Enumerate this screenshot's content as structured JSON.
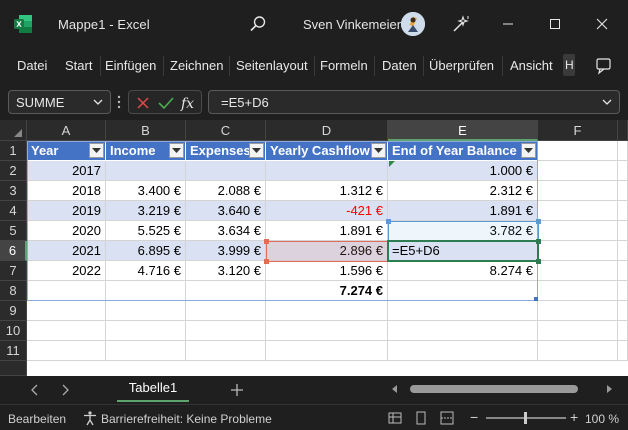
{
  "window": {
    "title": "Mappe1  -  Excel",
    "user": "Sven Vinkemeier"
  },
  "ribbon": {
    "tabs": [
      "Datei",
      "Start",
      "Einfügen",
      "Zeichnen",
      "Seitenlayout",
      "Formeln",
      "Daten",
      "Überprüfen",
      "Ansicht",
      "H"
    ]
  },
  "formula_bar": {
    "name_box": "SUMME",
    "formula": "=E5+D6"
  },
  "grid": {
    "columns": [
      "A",
      "B",
      "C",
      "D",
      "E",
      "F"
    ],
    "rows": [
      "1",
      "2",
      "3",
      "4",
      "5",
      "6",
      "7",
      "8",
      "9",
      "10",
      "11"
    ],
    "selected_cell": "E6",
    "table_headers": [
      "Year",
      "Income",
      "Expenses",
      "Yearly Cashflow",
      "End of Year Balance"
    ],
    "data": [
      {
        "year": "2017",
        "income": "",
        "expenses": "",
        "cashflow": "",
        "balance": "1.000 €"
      },
      {
        "year": "2018",
        "income": "3.400 €",
        "expenses": "2.088 €",
        "cashflow": "1.312 €",
        "balance": "2.312 €"
      },
      {
        "year": "2019",
        "income": "3.219 €",
        "expenses": "3.640 €",
        "cashflow": "-421 €",
        "balance": "1.891 €"
      },
      {
        "year": "2020",
        "income": "5.525 €",
        "expenses": "3.634 €",
        "cashflow": "1.891 €",
        "balance": "3.782 €"
      },
      {
        "year": "2021",
        "income": "6.895 €",
        "expenses": "3.999 €",
        "cashflow": "2.896 €",
        "balance": "=E5+D6"
      },
      {
        "year": "2022",
        "income": "4.716 €",
        "expenses": "3.120 €",
        "cashflow": "1.596 €",
        "balance": "8.274 €"
      }
    ],
    "total_row": {
      "cashflow": "7.274 €"
    }
  },
  "sheets": {
    "active": "Tabelle1"
  },
  "status": {
    "mode": "Bearbeiten",
    "accessibility": "Barrierefreiheit: Keine Probleme",
    "zoom": "100 %"
  },
  "colors": {
    "table_header": "#4472c4",
    "band": "#d9e1f2",
    "negative": "#ff0000",
    "excel_green": "#107c41"
  }
}
